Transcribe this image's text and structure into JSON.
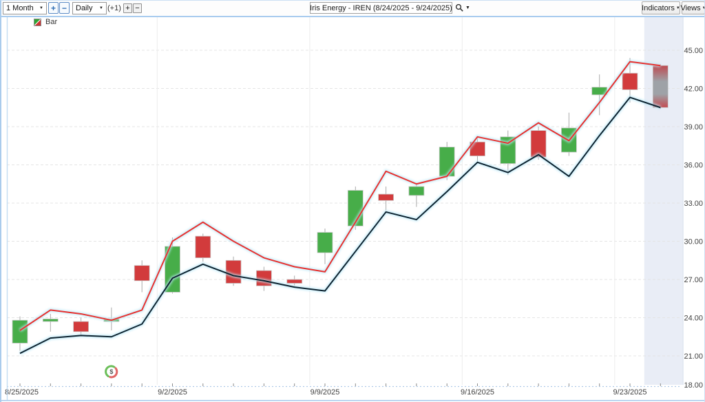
{
  "header": {
    "title": "Iris Energy - IREN (8/24/2025 - 9/24/2025)"
  },
  "toolbar": {
    "range_value": "1 Month",
    "zoom_in_label": "+",
    "zoom_out_label": "−",
    "period_value": "Daily",
    "offset_label": "(+1)",
    "bar_add_label": "+",
    "bar_remove_label": "−",
    "indicators_label": "Indicators",
    "views_label": "Views"
  },
  "legend": {
    "label": "Bar"
  },
  "colors": {
    "up": "#47AD49",
    "down": "#D23B3C",
    "candle_border": "#C9C9C9",
    "wick": "#A9A9A9",
    "line_upper": "#E8312F",
    "line_lower": "#0E2330",
    "glow": "#BCE9F8",
    "grid": "#E4E4E4",
    "week_separator": "#ECECEC",
    "highlight_strip": "#E9EDF6",
    "axis_dotted": "#AFCBE8",
    "tick": "#8A8A8A",
    "current_top": "#BE4950",
    "current_mid": "#9EA2A7",
    "current_bottom": "#C34B51",
    "marker_green": "#6BBF59",
    "marker_red": "#E06666",
    "frame_blue": "#A9CBEC",
    "chart_left_edge": "#C3DCF2"
  },
  "chart_data": {
    "type": "candlestick",
    "title": "Iris Energy - IREN (8/24/2025 - 9/24/2025)",
    "ylim": [
      18,
      45
    ],
    "y_axis": {
      "ticks": [
        {
          "value": 45,
          "label": "45.00"
        },
        {
          "value": 42,
          "label": "42.00"
        },
        {
          "value": 39,
          "label": "39.00"
        },
        {
          "value": 36,
          "label": "36.00"
        },
        {
          "value": 33,
          "label": "33.00"
        },
        {
          "value": 30,
          "label": "30.00"
        },
        {
          "value": 27,
          "label": "27.00"
        },
        {
          "value": 24,
          "label": "24.00"
        },
        {
          "value": 21,
          "label": "21.00"
        },
        {
          "value": 18,
          "label": "18.00"
        }
      ]
    },
    "x_axis": {
      "labels": [
        {
          "index": 0,
          "label": "8/25/2025"
        },
        {
          "index": 5,
          "label": "9/2/2025"
        },
        {
          "index": 10,
          "label": "9/9/2025"
        },
        {
          "index": 15,
          "label": "9/16/2025"
        },
        {
          "index": 20,
          "label": "9/23/2025"
        }
      ]
    },
    "candles": [
      {
        "date": "8/25/2025",
        "o": 22.0,
        "h": 24.1,
        "l": 21.4,
        "c": 23.8,
        "dir": "up"
      },
      {
        "date": "8/26/2025",
        "o": 23.7,
        "h": 24.3,
        "l": 22.9,
        "c": 23.9,
        "dir": "up"
      },
      {
        "date": "8/27/2025",
        "o": 23.7,
        "h": 24.0,
        "l": 22.6,
        "c": 22.9,
        "dir": "down"
      },
      {
        "date": "8/28/2025",
        "o": 23.7,
        "h": 24.8,
        "l": 23.0,
        "c": 23.9,
        "dir": "up"
      },
      {
        "date": "8/29/2025",
        "o": 28.1,
        "h": 28.5,
        "l": 26.0,
        "c": 26.9,
        "dir": "down"
      },
      {
        "date": "9/2/2025",
        "o": 26.0,
        "h": 30.3,
        "l": 25.9,
        "c": 29.6,
        "dir": "up"
      },
      {
        "date": "9/3/2025",
        "o": 30.4,
        "h": 30.6,
        "l": 28.4,
        "c": 28.7,
        "dir": "down"
      },
      {
        "date": "9/4/2025",
        "o": 28.5,
        "h": 28.8,
        "l": 26.5,
        "c": 26.7,
        "dir": "down"
      },
      {
        "date": "9/5/2025",
        "o": 27.7,
        "h": 28.0,
        "l": 26.1,
        "c": 26.5,
        "dir": "down"
      },
      {
        "date": "9/8/2025",
        "o": 27.0,
        "h": 27.3,
        "l": 26.5,
        "c": 26.7,
        "dir": "down"
      },
      {
        "date": "9/9/2025",
        "o": 29.1,
        "h": 31.0,
        "l": 28.2,
        "c": 30.7,
        "dir": "up"
      },
      {
        "date": "9/10/2025",
        "o": 31.2,
        "h": 34.3,
        "l": 30.9,
        "c": 34.0,
        "dir": "up"
      },
      {
        "date": "9/11/2025",
        "o": 33.7,
        "h": 34.3,
        "l": 32.4,
        "c": 33.2,
        "dir": "down"
      },
      {
        "date": "9/12/2025",
        "o": 33.6,
        "h": 34.6,
        "l": 32.7,
        "c": 34.3,
        "dir": "up"
      },
      {
        "date": "9/15/2025",
        "o": 35.1,
        "h": 37.8,
        "l": 34.8,
        "c": 37.4,
        "dir": "up"
      },
      {
        "date": "9/16/2025",
        "o": 37.8,
        "h": 38.1,
        "l": 36.2,
        "c": 36.7,
        "dir": "down"
      },
      {
        "date": "9/17/2025",
        "o": 36.1,
        "h": 38.7,
        "l": 35.2,
        "c": 38.2,
        "dir": "up"
      },
      {
        "date": "9/18/2025",
        "o": 38.7,
        "h": 39.0,
        "l": 36.4,
        "c": 36.6,
        "dir": "down"
      },
      {
        "date": "9/19/2025",
        "o": 37.0,
        "h": 40.1,
        "l": 36.7,
        "c": 38.9,
        "dir": "up"
      },
      {
        "date": "9/22/2025",
        "o": 41.5,
        "h": 43.1,
        "l": 39.9,
        "c": 42.1,
        "dir": "up"
      },
      {
        "date": "9/23/2025",
        "o": 43.2,
        "h": 44.4,
        "l": 40.9,
        "c": 41.9,
        "dir": "down"
      },
      {
        "date": "9/24/2025",
        "o": 43.8,
        "h": 43.9,
        "l": 40.4,
        "c": 40.5,
        "dir": "current"
      }
    ],
    "series": [
      {
        "name": "upper-envelope-line",
        "color": "#E8312F",
        "values": [
          23.0,
          24.6,
          24.3,
          23.8,
          24.6,
          30.0,
          31.5,
          30.0,
          28.7,
          28.0,
          27.6,
          31.5,
          35.5,
          34.5,
          35.1,
          38.2,
          37.7,
          39.3,
          37.9,
          40.9,
          44.1,
          43.8
        ]
      },
      {
        "name": "lower-envelope-line",
        "color": "#0E2330",
        "values": [
          21.2,
          22.4,
          22.6,
          22.5,
          23.5,
          27.1,
          28.2,
          27.3,
          26.9,
          26.4,
          26.1,
          29.2,
          32.3,
          31.7,
          33.9,
          36.2,
          35.4,
          36.8,
          35.1,
          38.3,
          41.3,
          40.5
        ]
      }
    ],
    "event_marker": {
      "index": 3,
      "date": "8/28/2025",
      "glyph": "$"
    },
    "current_bar": {
      "index": 21,
      "highlighted": true
    }
  }
}
